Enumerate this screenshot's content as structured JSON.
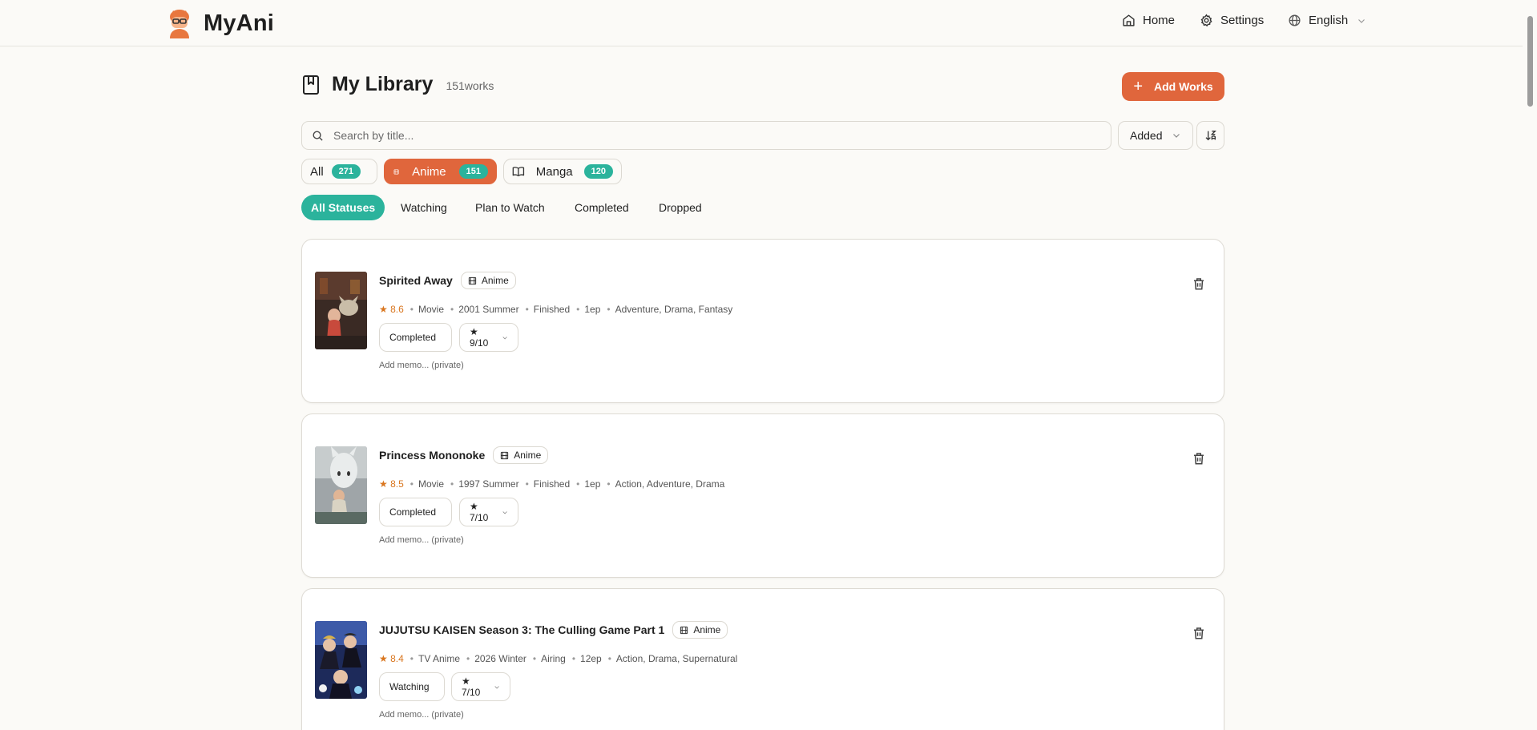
{
  "header": {
    "brand": "MyAni",
    "nav": {
      "home": "Home",
      "settings": "Settings",
      "language": "English"
    }
  },
  "library": {
    "title": "My Library",
    "count_label": "151works",
    "add_label": "Add Works",
    "search_placeholder": "Search by title...",
    "sort_value": "Added"
  },
  "type_filters": [
    {
      "label": "All",
      "count": "271",
      "active": false
    },
    {
      "label": "Anime",
      "count": "151",
      "active": true
    },
    {
      "label": "Manga",
      "count": "120",
      "active": false
    }
  ],
  "status_filters": [
    {
      "label": "All Statuses",
      "active": true
    },
    {
      "label": "Watching"
    },
    {
      "label": "Plan to Watch"
    },
    {
      "label": "Completed"
    },
    {
      "label": "Dropped"
    }
  ],
  "works": [
    {
      "title": "Spirited Away",
      "kind": "Anime",
      "score": "★ 8.6",
      "format": "Movie",
      "season": "2001 Summer",
      "state": "Finished",
      "episodes": "1ep",
      "genres": "Adventure, Drama, Fantasy",
      "status": "Completed",
      "rating": "★ 9/10",
      "memo": "Add memo... (private)"
    },
    {
      "title": "Princess Mononoke",
      "kind": "Anime",
      "score": "★ 8.5",
      "format": "Movie",
      "season": "1997 Summer",
      "state": "Finished",
      "episodes": "1ep",
      "genres": "Action, Adventure, Drama",
      "status": "Completed",
      "rating": "★ 7/10",
      "memo": "Add memo... (private)"
    },
    {
      "title": "JUJUTSU KAISEN Season 3: The Culling Game Part 1",
      "kind": "Anime",
      "score": "★ 8.4",
      "format": "TV Anime",
      "season": "2026 Winter",
      "state": "Airing",
      "episodes": "12ep",
      "genres": "Action, Drama, Supernatural",
      "status": "Watching",
      "rating": "★ 7/10",
      "memo": "Add memo... (private)"
    }
  ],
  "colors": {
    "accent": "#e0663c",
    "teal": "#2bb39c",
    "score": "#d9761f"
  }
}
